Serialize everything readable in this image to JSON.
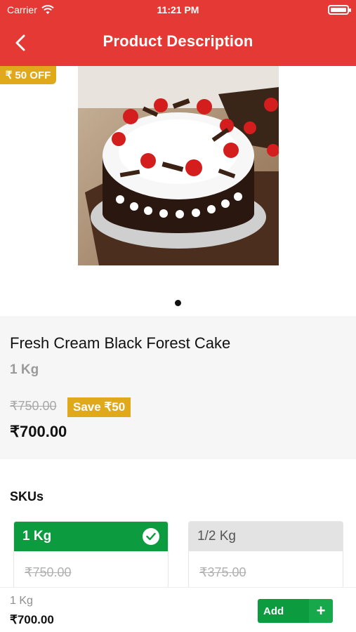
{
  "status_bar": {
    "carrier": "Carrier",
    "time": "11:21 PM"
  },
  "nav": {
    "title": "Product Description",
    "back_icon": "chevron-left-icon"
  },
  "product": {
    "discount_badge": "₹ 50 OFF",
    "name": "Fresh Cream Black Forest Cake",
    "weight": "1 Kg",
    "mrp": "₹750.00",
    "save_badge": "Save ₹50",
    "price": "₹700.00",
    "image_pages": 1,
    "current_page": 1
  },
  "skus": {
    "title": "SKUs",
    "items": [
      {
        "label": "1 Kg",
        "mrp": "₹750.00",
        "selected": true
      },
      {
        "label": "1/2 Kg",
        "mrp": "₹375.00",
        "selected": false
      }
    ]
  },
  "bottom_bar": {
    "weight": "1 Kg",
    "price": "₹700.00",
    "add_label": "Add",
    "add_icon": "plus-icon"
  },
  "colors": {
    "brand_red": "#e53935",
    "accent_green": "#0c9b3f",
    "badge_gold": "#e0a91b"
  }
}
